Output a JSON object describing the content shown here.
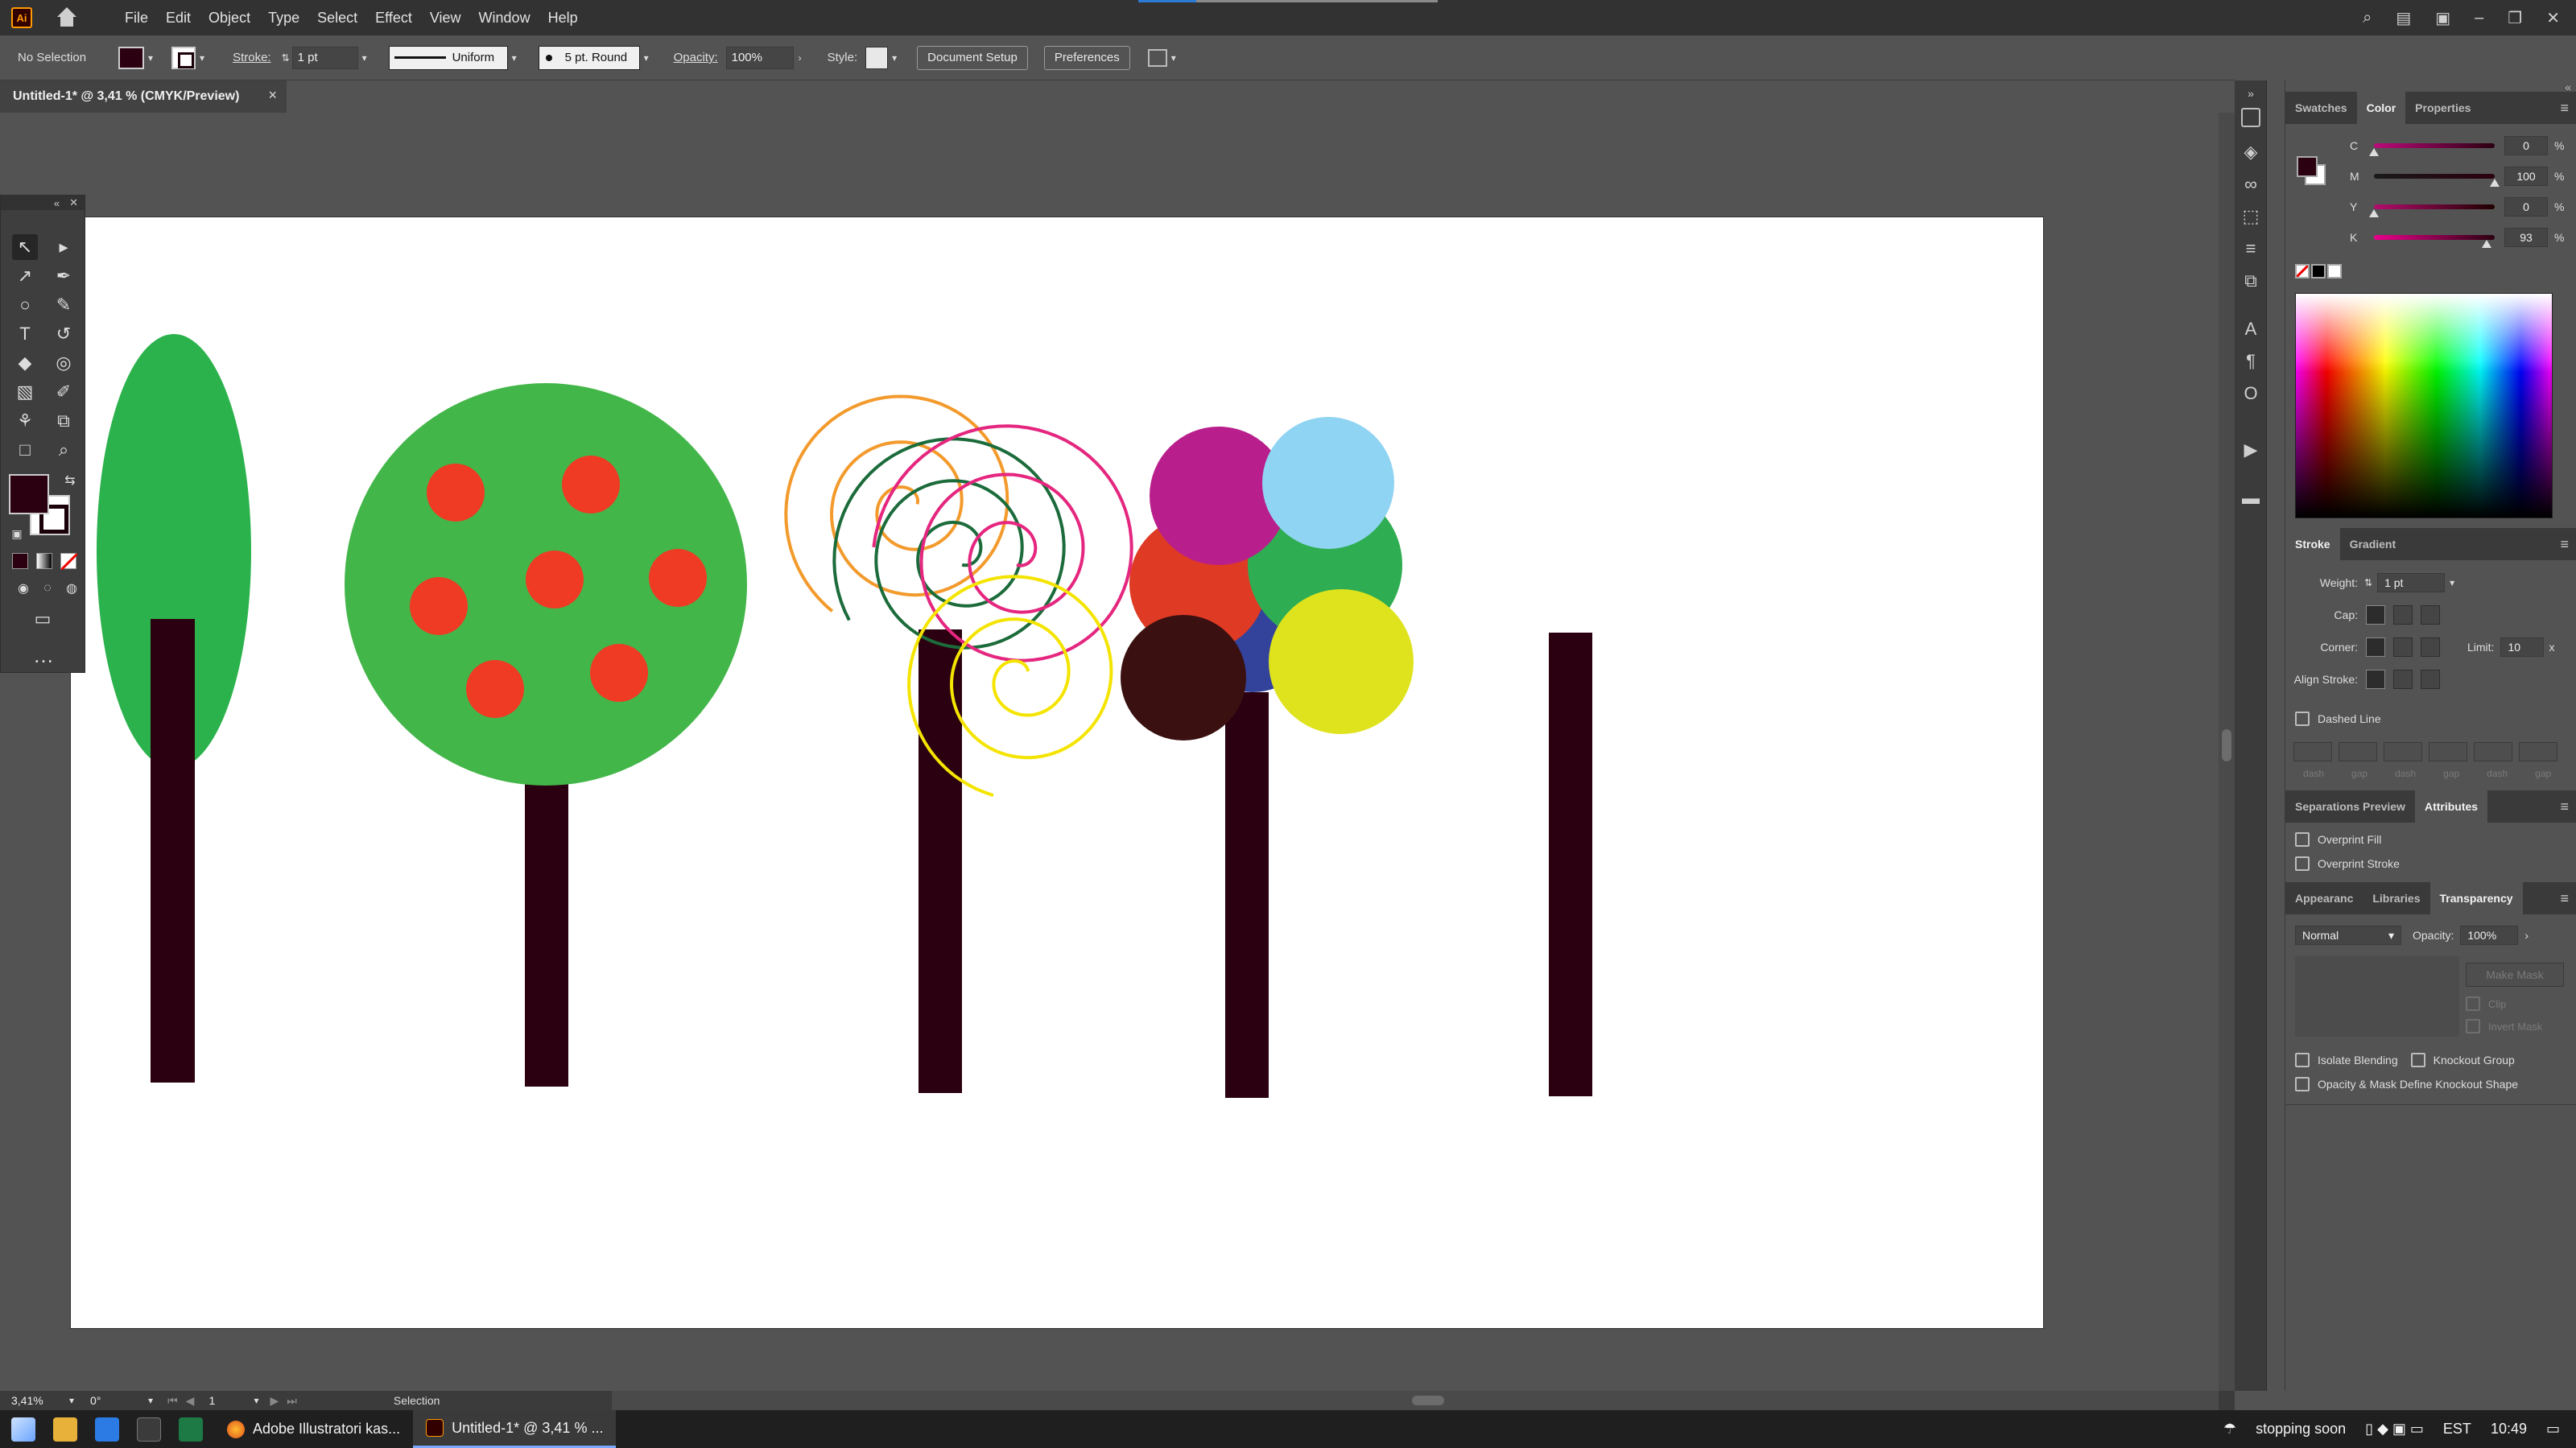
{
  "menubar": {
    "logo": "Ai",
    "items": [
      "File",
      "Edit",
      "Object",
      "Type",
      "Select",
      "Effect",
      "View",
      "Window",
      "Help"
    ]
  },
  "control_bar": {
    "selection_label": "No Selection",
    "stroke_label": "Stroke:",
    "stroke_weight": "1 pt",
    "stroke_profile": "Uniform",
    "brush_definition": "5 pt. Round",
    "opacity_label": "Opacity:",
    "opacity_value": "100%",
    "style_label": "Style:",
    "document_setup": "Document Setup",
    "preferences": "Preferences"
  },
  "document_tab": {
    "title": "Untitled-1* @ 3,41 % (CMYK/Preview)",
    "close": "×"
  },
  "color_panel": {
    "tabs": [
      "Swatches",
      "Color",
      "Properties"
    ],
    "active_tab": "Color",
    "channels": [
      {
        "name": "C",
        "value": "0"
      },
      {
        "name": "M",
        "value": "100"
      },
      {
        "name": "Y",
        "value": "0"
      },
      {
        "name": "K",
        "value": "93"
      }
    ],
    "percent": "%"
  },
  "stroke_panel": {
    "tabs": [
      "Stroke",
      "Gradient"
    ],
    "weight_label": "Weight:",
    "weight_value": "1 pt",
    "cap_label": "Cap:",
    "corner_label": "Corner:",
    "limit_label": "Limit:",
    "limit_value": "10",
    "limit_unit": "x",
    "align_label": "Align Stroke:",
    "dashed_line": "Dashed Line",
    "dash_labels": [
      "dash",
      "gap",
      "dash",
      "gap",
      "dash",
      "gap"
    ]
  },
  "attributes_panel": {
    "tabs": [
      "Separations Preview",
      "Attributes"
    ],
    "overprint_fill": "Overprint Fill",
    "overprint_stroke": "Overprint Stroke"
  },
  "transparency_panel": {
    "tabs": [
      "Appearanc",
      "Libraries",
      "Transparency"
    ],
    "blend_mode": "Normal",
    "opacity_label": "Opacity:",
    "opacity_value": "100%",
    "make_mask": "Make Mask",
    "clip": "Clip",
    "invert_mask": "Invert Mask",
    "isolate_blending": "Isolate Blending",
    "knockout_group": "Knockout Group",
    "opacity_mask": "Opacity & Mask Define Knockout Shape"
  },
  "status_bar": {
    "zoom": "3,41%",
    "rotation": "0°",
    "artboard_num": "1",
    "tool": "Selection"
  },
  "taskbar": {
    "task1": "Adobe Illustratori kas...",
    "task2": "Untitled-1* @ 3,41 % ...",
    "weather": "stopping soon",
    "lang": "EST",
    "time": "10:49"
  },
  "colors": {
    "trunk": "#2b0010",
    "green_dark": "#2bb24c",
    "green_light": "#43b649",
    "apple_red": "#ef3a24",
    "magenta": "#b81f8c",
    "sky_blue": "#8fd4f2",
    "orange_red": "#de3a24",
    "green_circle": "#2fad52",
    "navy": "#33439c",
    "maroon": "#3a1010",
    "yellow": "#dfe31d"
  }
}
